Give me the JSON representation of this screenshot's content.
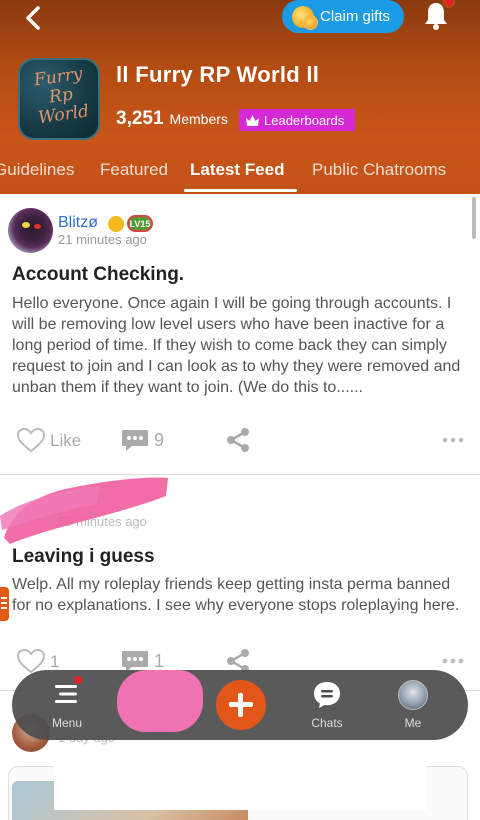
{
  "header": {
    "claim_gifts": "Claim gifts",
    "community_title": "ll Furry RP World ll",
    "avatar_text": "Furry\nRp\nWorld",
    "members_count": "3,251",
    "members_label": "Members",
    "leaderboards": "Leaderboards",
    "colors": {
      "header": "#c4521a",
      "claim": "#1a9be6",
      "leaderboards": "#d629d6"
    }
  },
  "tabs": [
    {
      "label": "Guidelines"
    },
    {
      "label": "Featured"
    },
    {
      "label": "Latest Feed",
      "active": true
    },
    {
      "label": "Public Chatrooms"
    }
  ],
  "posts": [
    {
      "author": "Blitzø",
      "level_badge": "LV15",
      "time": "21 minutes ago",
      "title": "Account Checking.",
      "body": "Hello everyone. Once again I will be going through accounts. I will be removing low level users who have been inactive for a long period of time. If they wish to come back they can simply request to join and I can look as to why they were removed and unban them if they want to join. (We do this to......",
      "like_label": "Like",
      "comments": "9"
    },
    {
      "time": "55 minutes ago",
      "title": "Leaving i guess",
      "body": "Welp. All my roleplay friends keep getting insta perma banned for no explanations. I see why everyone stops roleplaying here.",
      "likes": "1",
      "comments": "1"
    },
    {
      "time": "1 day ago"
    }
  ],
  "bottom_nav": {
    "menu": "Menu",
    "chats": "Chats",
    "me": "Me"
  }
}
